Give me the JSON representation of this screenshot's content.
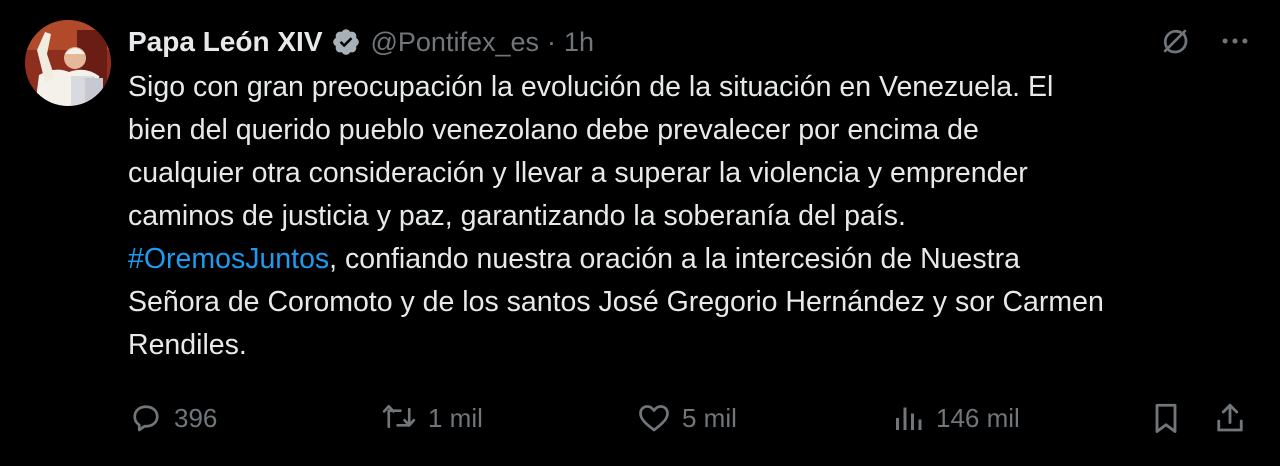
{
  "author": {
    "name": "Papa León XIV",
    "handle": "@Pontifex_es",
    "separator": "·",
    "time": "1h",
    "verified": true
  },
  "tweet": {
    "lines": [
      "Sigo con gran preocupación la evolución de la situación en Venezuela. El",
      "bien del querido pueblo venezolano debe prevalecer por encima de",
      "cualquier otra consideración y llevar a superar la violencia y emprender",
      "caminos de justicia y paz, garantizando la soberanía del país."
    ],
    "hashtag": "#OremosJuntos",
    "after_hashtag": ", confiando nuestra oración a la intercesión de Nuestra",
    "lines_after": [
      "Señora de Coromoto y de los santos José Gregorio Hernández y sor Carmen",
      "Rendiles."
    ]
  },
  "actions": {
    "replies": "396",
    "reposts": "1 mil",
    "likes": "5 mil",
    "views": "146 mil"
  },
  "icons": {
    "verified": "verified-badge-icon",
    "grok": "grok-icon",
    "more": "more-icon",
    "reply": "reply-icon",
    "repost": "repost-icon",
    "like": "heart-icon",
    "views": "views-icon",
    "bookmark": "bookmark-icon",
    "share": "share-icon"
  },
  "colors": {
    "background": "#000000",
    "text": "#e7e9ea",
    "secondary": "#71767b",
    "link": "#1d9bf0"
  }
}
